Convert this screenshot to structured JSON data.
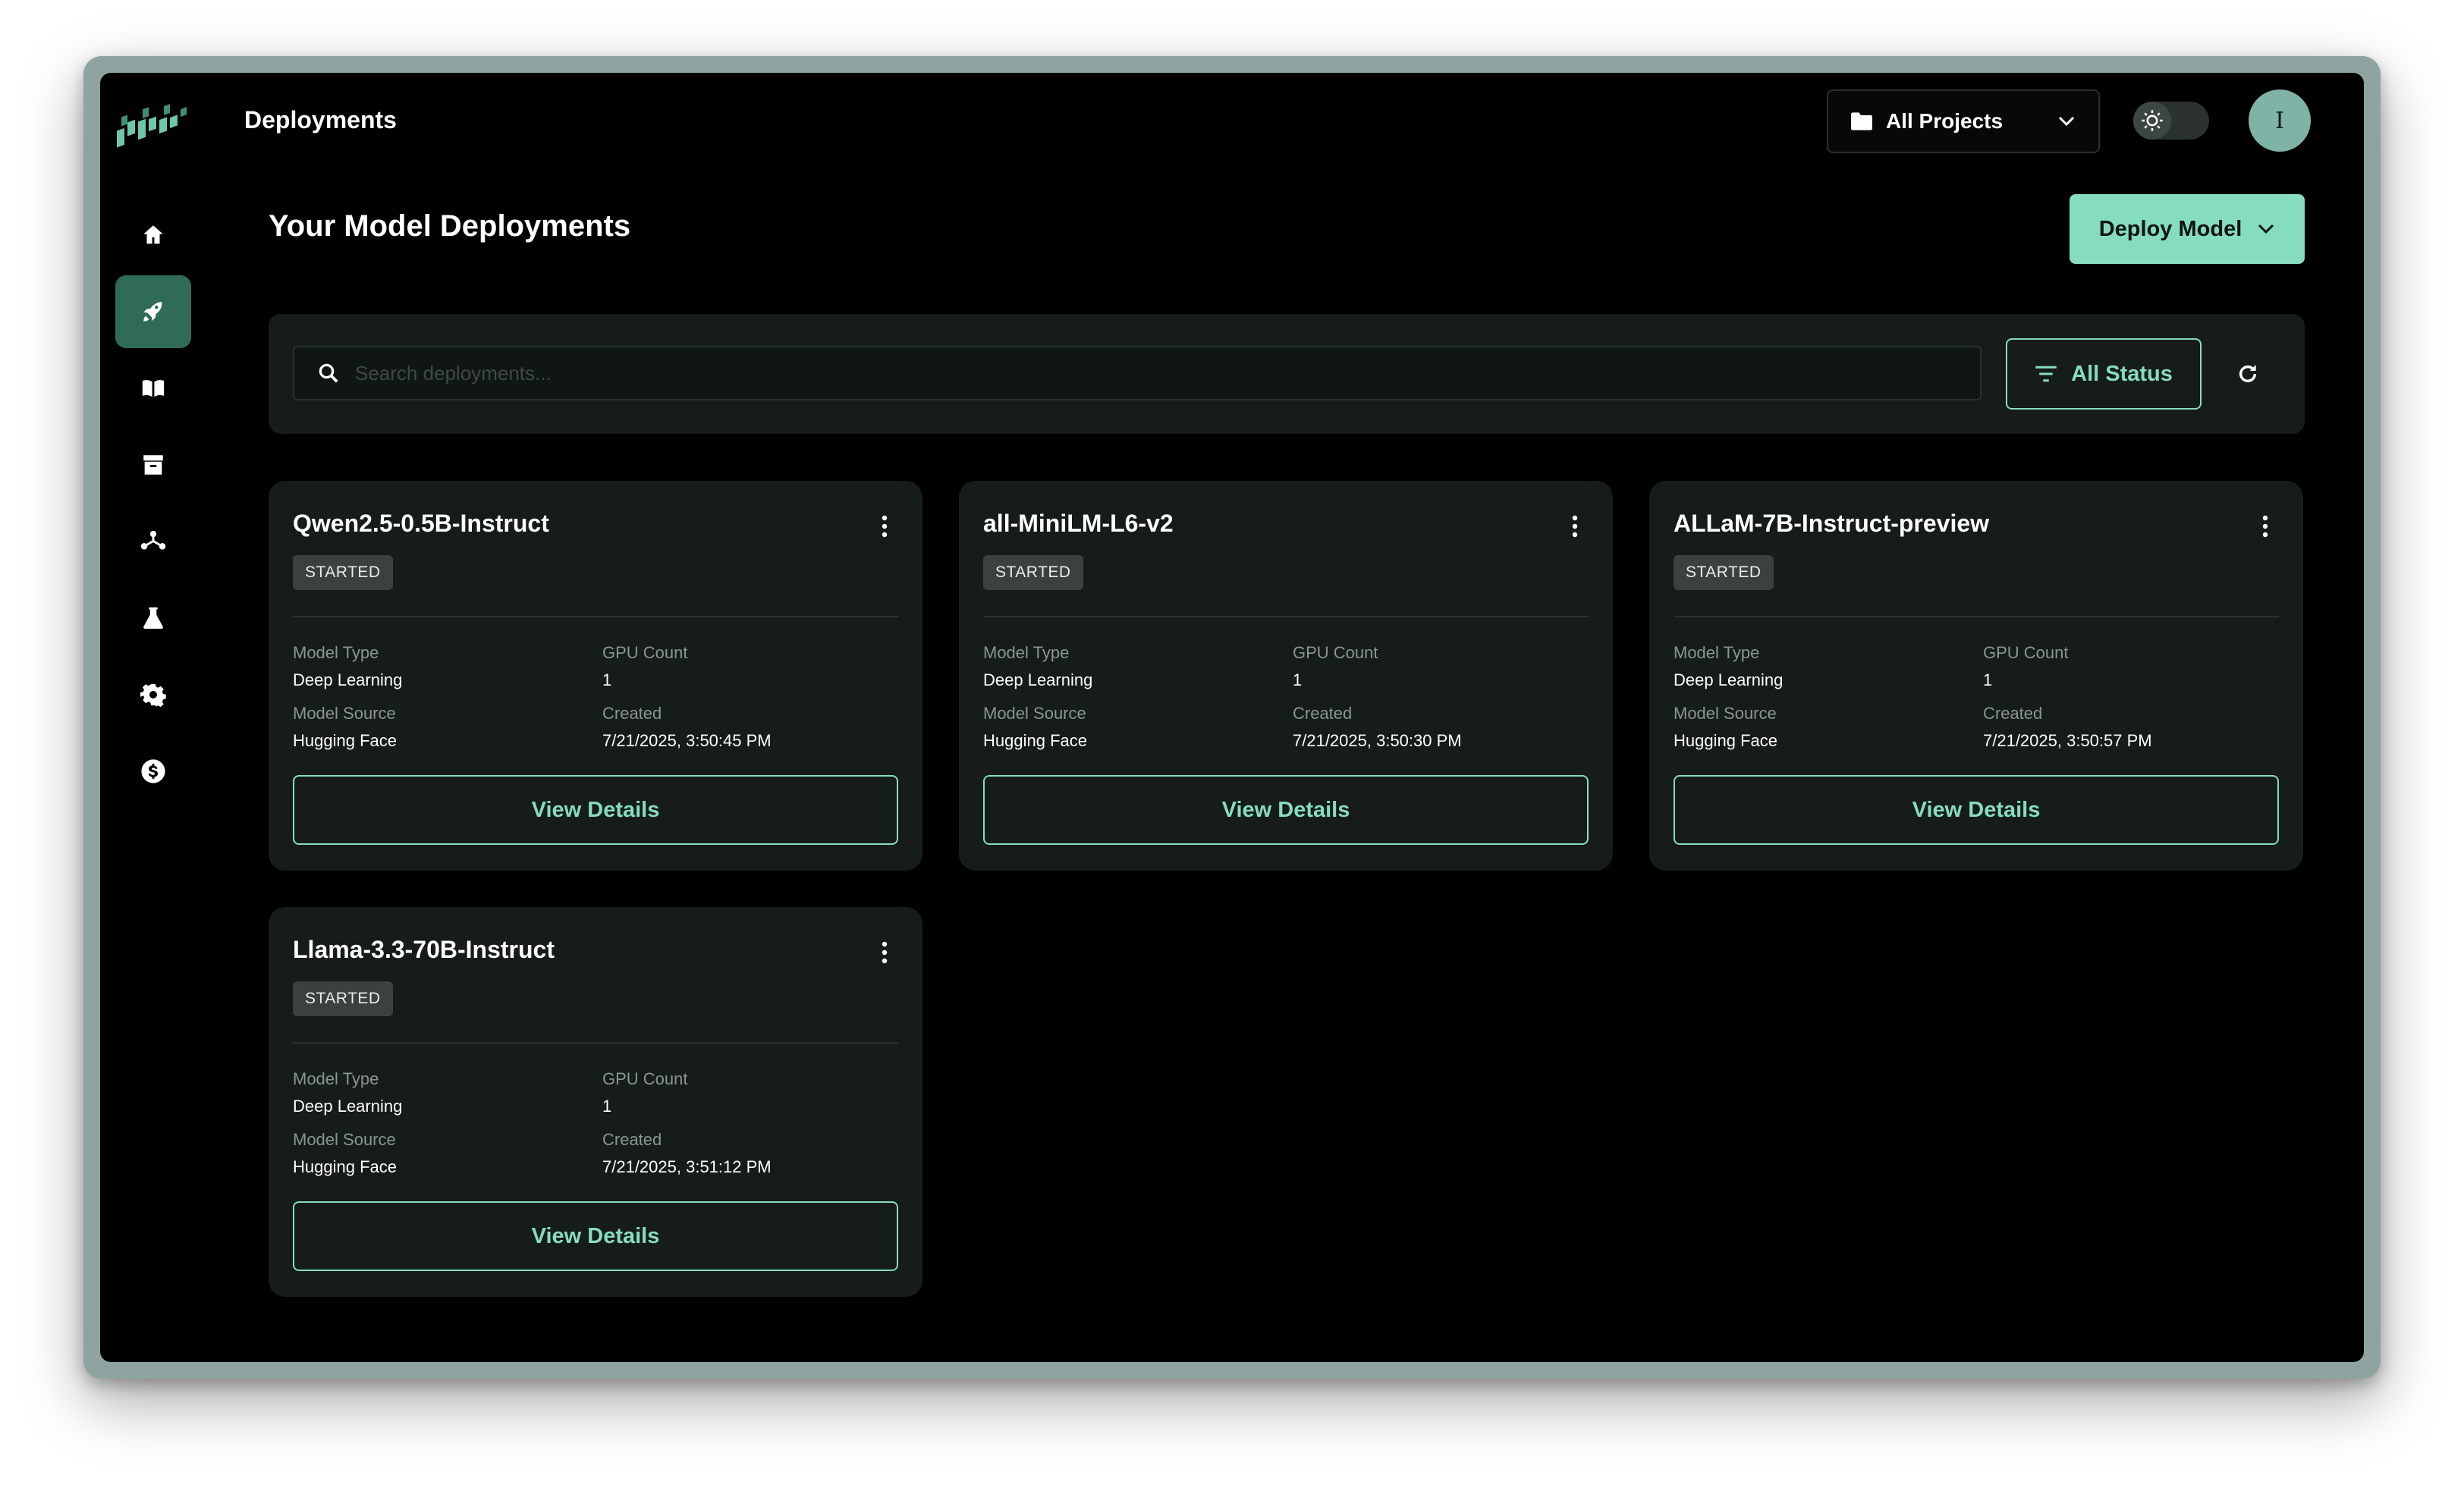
{
  "header": {
    "title": "Deployments",
    "project_select": "All Projects",
    "avatar_initial": "I"
  },
  "main": {
    "page_title": "Your Model Deployments",
    "deploy_button": "Deploy Model",
    "search_placeholder": "Search deployments...",
    "status_filter": "All Status"
  },
  "sidebar": {
    "items": [
      {
        "name": "home-icon",
        "active": false
      },
      {
        "name": "rocket-icon",
        "active": true
      },
      {
        "name": "book-icon",
        "active": false
      },
      {
        "name": "archive-icon",
        "active": false
      },
      {
        "name": "network-icon",
        "active": false
      },
      {
        "name": "flask-icon",
        "active": false
      },
      {
        "name": "gear-icon",
        "active": false
      },
      {
        "name": "dollar-icon",
        "active": false
      }
    ]
  },
  "labels": {
    "model_type": "Model Type",
    "gpu_count": "GPU Count",
    "model_source": "Model Source",
    "created": "Created",
    "view_details": "View Details"
  },
  "deployments": [
    {
      "name": "Qwen2.5-0.5B-Instruct",
      "status": "STARTED",
      "model_type": "Deep Learning",
      "gpu_count": "1",
      "model_source": "Hugging Face",
      "created": "7/21/2025, 3:50:45 PM"
    },
    {
      "name": "all-MiniLM-L6-v2",
      "status": "STARTED",
      "model_type": "Deep Learning",
      "gpu_count": "1",
      "model_source": "Hugging Face",
      "created": "7/21/2025, 3:50:30 PM"
    },
    {
      "name": "ALLaM-7B-Instruct-preview",
      "status": "STARTED",
      "model_type": "Deep Learning",
      "gpu_count": "1",
      "model_source": "Hugging Face",
      "created": "7/21/2025, 3:50:57 PM"
    },
    {
      "name": "Llama-3.3-70B-Instruct",
      "status": "STARTED",
      "model_type": "Deep Learning",
      "gpu_count": "1",
      "model_source": "Hugging Face",
      "created": "7/21/2025, 3:51:12 PM"
    }
  ],
  "colors": {
    "accent": "#86dcc1",
    "active_nav": "#2f6b57",
    "card_bg": "#161b1b",
    "background": "#000000"
  }
}
